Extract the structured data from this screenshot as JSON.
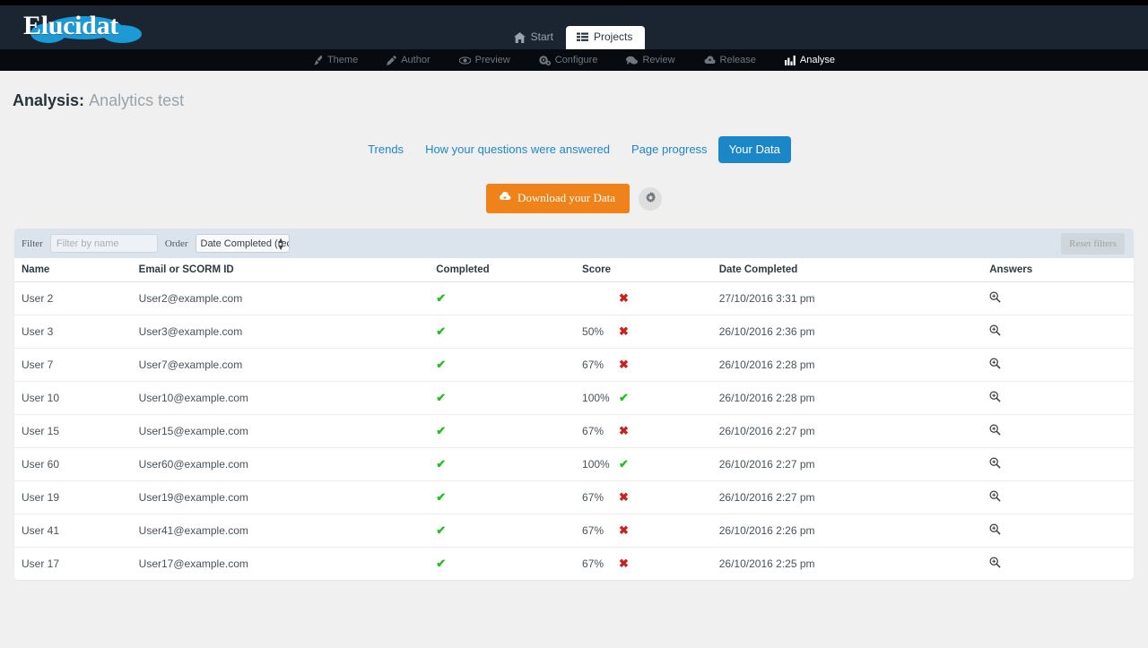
{
  "brand": {
    "name": "Elucidat",
    "cloud_color": "#1b9ad6"
  },
  "header": {
    "tabs": [
      {
        "label": "Start",
        "icon": "home-icon",
        "active": false
      },
      {
        "label": "Projects",
        "icon": "list-icon",
        "active": true
      }
    ]
  },
  "subnav": {
    "items": [
      {
        "label": "Theme",
        "icon": "brush-icon",
        "active": false
      },
      {
        "label": "Author",
        "icon": "pencil-icon",
        "active": false
      },
      {
        "label": "Preview",
        "icon": "eye-icon",
        "active": false
      },
      {
        "label": "Configure",
        "icon": "gears-icon",
        "active": false
      },
      {
        "label": "Review",
        "icon": "comments-icon",
        "active": false
      },
      {
        "label": "Release",
        "icon": "cloud-upload-icon",
        "active": false
      },
      {
        "label": "Analyse",
        "icon": "bar-chart-icon",
        "active": true
      }
    ]
  },
  "page": {
    "title_prefix": "Analysis:",
    "title_name": "Analytics test"
  },
  "analysis_tabs": [
    {
      "label": "Trends",
      "active": false
    },
    {
      "label": "How your questions were answered",
      "active": false
    },
    {
      "label": "Page progress",
      "active": false
    },
    {
      "label": "Your Data",
      "active": true
    }
  ],
  "actions": {
    "download_label": "Download your Data",
    "download_icon": "cloud-download-icon",
    "download_color": "#ef8219",
    "settings_icon": "gear-icon"
  },
  "filters": {
    "filter_label": "Filter",
    "filter_placeholder": "Filter by name",
    "filter_value": "",
    "order_label": "Order",
    "order_value": "Date Completed (recer",
    "reset_label": "Reset filters"
  },
  "table": {
    "columns": [
      "Name",
      "Email or SCORM ID",
      "Completed",
      "Score",
      "Date Completed",
      "Answers"
    ],
    "answers_icon": "search-plus-icon",
    "rows": [
      {
        "name": "User 2",
        "email": "User2@example.com",
        "completed": "tick",
        "score": "",
        "score_mark": "cross",
        "date": "27/10/2016 3:31 pm"
      },
      {
        "name": "User 3",
        "email": "User3@example.com",
        "completed": "tick",
        "score": "50%",
        "score_mark": "cross",
        "date": "26/10/2016 2:36 pm"
      },
      {
        "name": "User 7",
        "email": "User7@example.com",
        "completed": "tick",
        "score": "67%",
        "score_mark": "cross",
        "date": "26/10/2016 2:28 pm"
      },
      {
        "name": "User 10",
        "email": "User10@example.com",
        "completed": "tick",
        "score": "100%",
        "score_mark": "tick",
        "date": "26/10/2016 2:28 pm"
      },
      {
        "name": "User 15",
        "email": "User15@example.com",
        "completed": "tick",
        "score": "67%",
        "score_mark": "cross",
        "date": "26/10/2016 2:27 pm"
      },
      {
        "name": "User 60",
        "email": "User60@example.com",
        "completed": "tick",
        "score": "100%",
        "score_mark": "tick",
        "date": "26/10/2016 2:27 pm"
      },
      {
        "name": "User 19",
        "email": "User19@example.com",
        "completed": "tick",
        "score": "67%",
        "score_mark": "cross",
        "date": "26/10/2016 2:27 pm"
      },
      {
        "name": "User 41",
        "email": "User41@example.com",
        "completed": "tick",
        "score": "67%",
        "score_mark": "cross",
        "date": "26/10/2016 2:26 pm"
      },
      {
        "name": "User 17",
        "email": "User17@example.com",
        "completed": "tick",
        "score": "67%",
        "score_mark": "cross",
        "date": "26/10/2016 2:25 pm"
      }
    ]
  }
}
